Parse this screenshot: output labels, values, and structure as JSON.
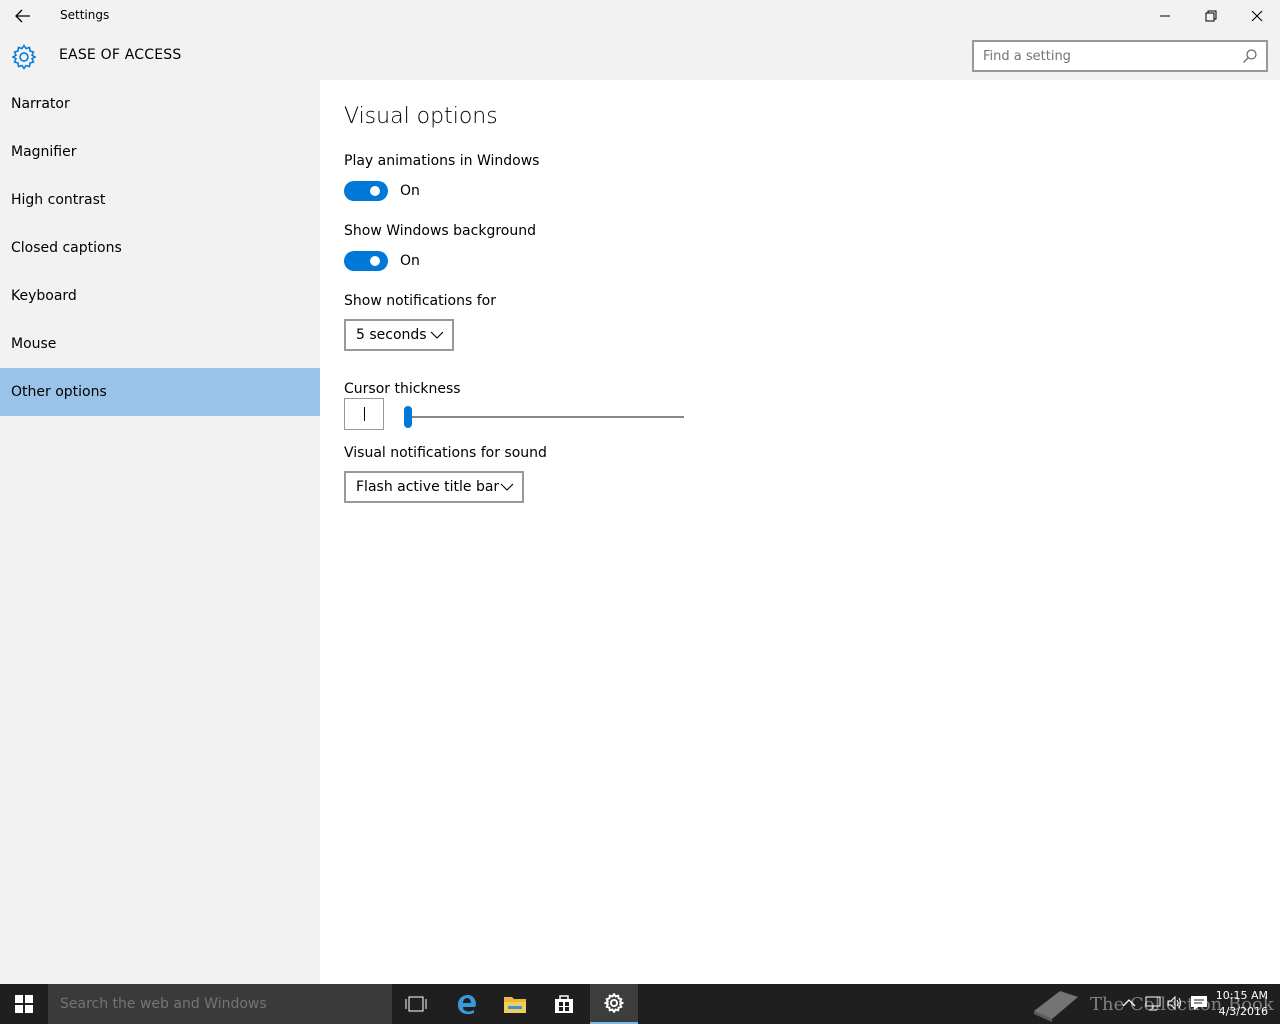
{
  "window": {
    "title": "Settings",
    "controls": [
      "minimize",
      "restore",
      "close"
    ]
  },
  "header": {
    "section_title": "EASE OF ACCESS",
    "search_placeholder": "Find a setting"
  },
  "sidebar": {
    "items": [
      {
        "label": "Narrator"
      },
      {
        "label": "Magnifier"
      },
      {
        "label": "High contrast"
      },
      {
        "label": "Closed captions"
      },
      {
        "label": "Keyboard"
      },
      {
        "label": "Mouse"
      },
      {
        "label": "Other options",
        "active": true
      }
    ]
  },
  "main": {
    "title": "Visual options",
    "animations": {
      "label": "Play animations in Windows",
      "state": "On",
      "on": true
    },
    "background": {
      "label": "Show Windows background",
      "state": "On",
      "on": true
    },
    "notifications": {
      "label": "Show notifications for",
      "value": "5 seconds"
    },
    "cursor": {
      "label": "Cursor thickness",
      "value_fraction": 0.0
    },
    "sound": {
      "label": "Visual notifications for sound",
      "value": "Flash active title bar"
    }
  },
  "taskbar": {
    "search_placeholder": "Search the web and Windows",
    "watermark": "The Collection Book",
    "time": "10:15 AM",
    "date": "4/3/2016",
    "accent": "#0078d7"
  }
}
